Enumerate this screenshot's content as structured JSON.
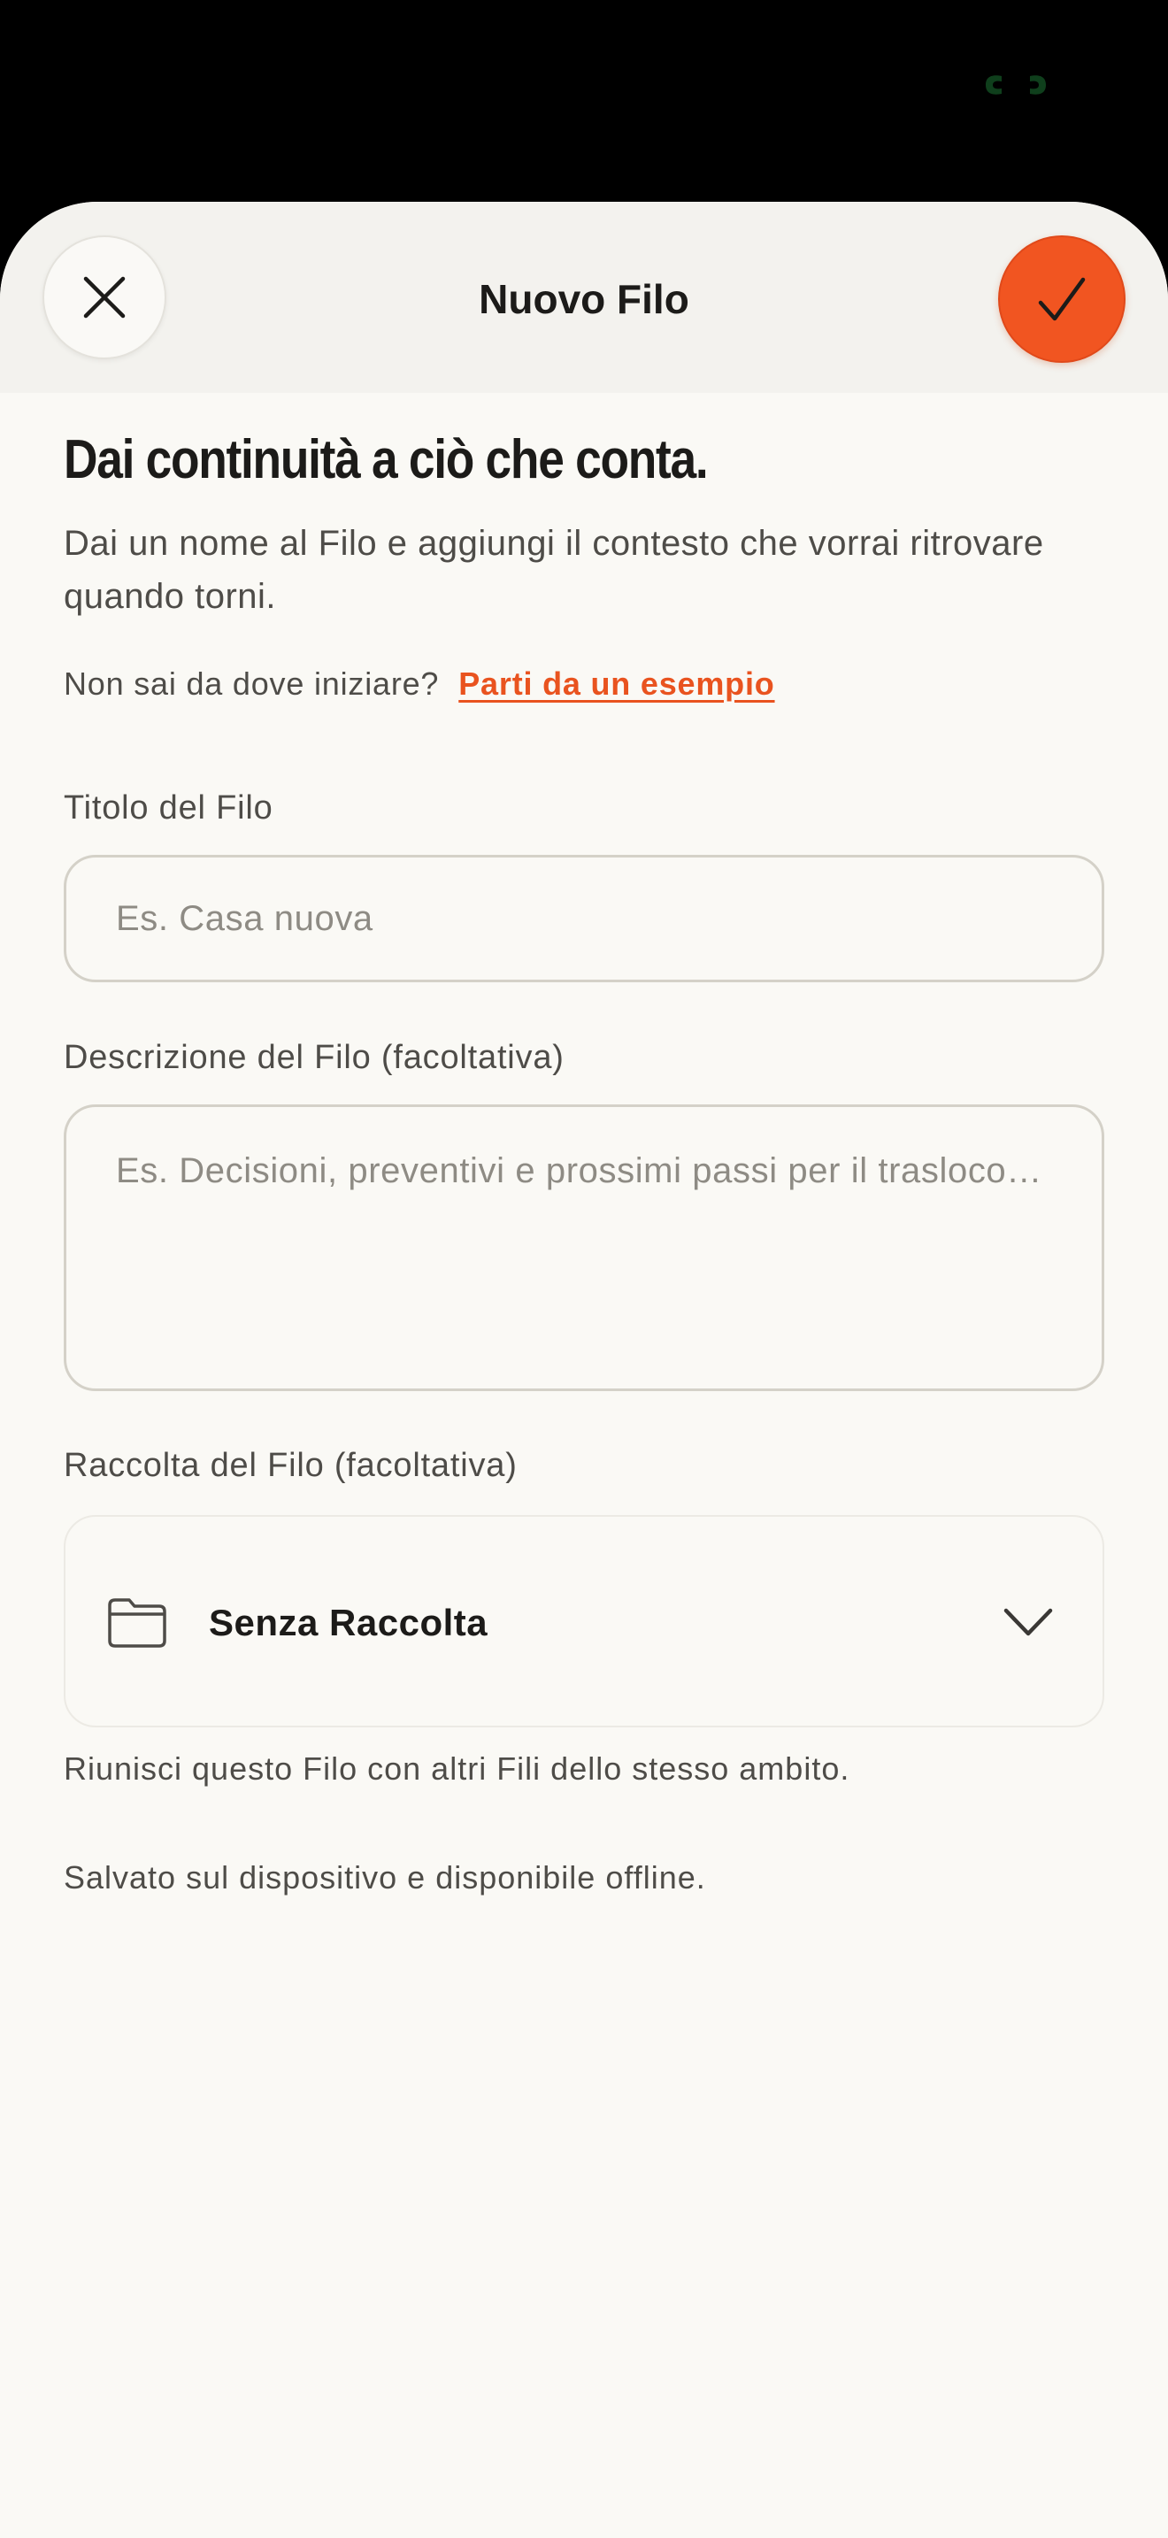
{
  "sheet": {
    "title": "Nuovo Filo",
    "close_icon": "close-icon",
    "confirm_icon": "checkmark-icon"
  },
  "intro": {
    "headline": "Dai continuità a ciò che conta.",
    "description": "Dai un nome al Filo e aggiungi il contesto che vorrai ritrovare quando torni.",
    "hint_prefix": "Non sai da dove iniziare?",
    "hint_link": "Parti da un esempio"
  },
  "form": {
    "title_label": "Titolo del Filo",
    "title_placeholder": "Es. Casa nuova",
    "title_value": "",
    "description_label": "Descrizione del Filo (facoltativa)",
    "description_placeholder": "Es. Decisioni, preventivi e prossimi passi per il trasloco…",
    "description_value": "",
    "collection_label": "Raccolta del Filo (facoltativa)",
    "collection_value": "Senza Raccolta",
    "collection_icon": "folder-icon",
    "collection_hint": "Riunisci questo Filo con altri Fili dello stesso ambito.",
    "storage_note": "Salvato sul dispositivo e disponibile offline."
  },
  "colors": {
    "accent": "#F15521",
    "background": "#FAF9F5",
    "header": "#F3F2EE",
    "text_primary": "#1C1B19",
    "text_secondary": "#4E4C48",
    "placeholder": "#8E8B84"
  }
}
